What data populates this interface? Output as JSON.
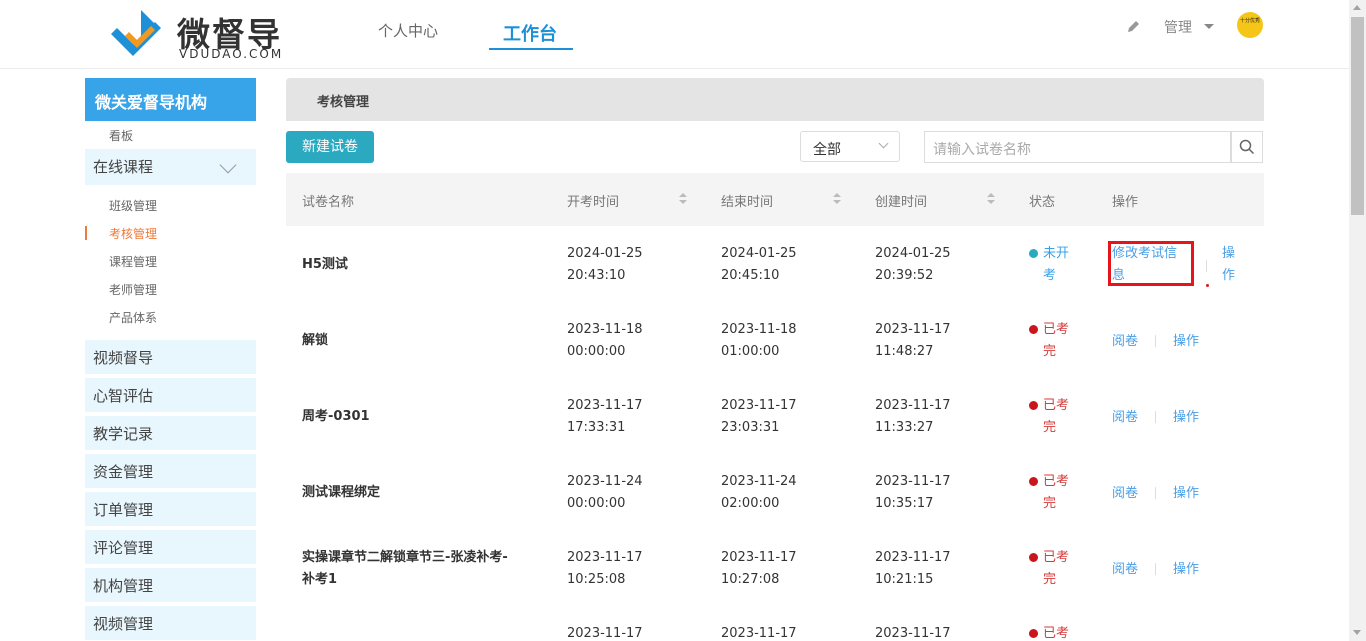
{
  "header": {
    "logo_title": "微督导",
    "logo_sub": "VDUDAO.COM",
    "nav": [
      "个人中心",
      "工作台"
    ],
    "manage_label": "管理",
    "avatar_text": "十分优秀"
  },
  "sidebar": {
    "org_name": "微关爱督导机构",
    "dashboard": "看板",
    "online_course": "在线课程",
    "sub_items": [
      "班级管理",
      "考核管理",
      "课程管理",
      "老师管理",
      "产品体系"
    ],
    "blocks": [
      "视频督导",
      "心智评估",
      "教学记录",
      "资金管理",
      "订单管理",
      "评论管理",
      "机构管理",
      "视频管理"
    ]
  },
  "main": {
    "breadcrumb": "考核管理",
    "new_button": "新建试卷",
    "filter_value": "全部",
    "search_placeholder": "请输入试卷名称",
    "columns": [
      "试卷名称",
      "开考时间",
      "结束时间",
      "创建时间",
      "状态",
      "操作"
    ],
    "rows": [
      {
        "name": "H5测试",
        "start_date": "2024-01-25",
        "start_time": "20:43:10",
        "end_date": "2024-01-25",
        "end_time": "20:45:10",
        "create_date": "2024-01-25",
        "create_time": "20:39:52",
        "status1": "未开",
        "status2": "考",
        "action1a": "修改考试信",
        "action1b": "息",
        "action2a": "操",
        "action2b": "作"
      },
      {
        "name": "解锁",
        "start_date": "2023-11-18",
        "start_time": "00:00:00",
        "end_date": "2023-11-18",
        "end_time": "01:00:00",
        "create_date": "2023-11-17",
        "create_time": "11:48:27",
        "status1": "已考",
        "status2": "完",
        "action1": "阅卷",
        "action2": "操作"
      },
      {
        "name": "周考-0301",
        "start_date": "2023-11-17",
        "start_time": "17:33:31",
        "end_date": "2023-11-17",
        "end_time": "23:03:31",
        "create_date": "2023-11-17",
        "create_time": "11:33:27",
        "status1": "已考",
        "status2": "完",
        "action1": "阅卷",
        "action2": "操作"
      },
      {
        "name": "测试课程绑定",
        "start_date": "2023-11-24",
        "start_time": "00:00:00",
        "end_date": "2023-11-24",
        "end_time": "02:00:00",
        "create_date": "2023-11-17",
        "create_time": "10:35:17",
        "status1": "已考",
        "status2": "完",
        "action1": "阅卷",
        "action2": "操作"
      },
      {
        "name1": "实操课章节二解锁章节三-张凌补考-",
        "name2": "补考1",
        "start_date": "2023-11-17",
        "start_time": "10:25:08",
        "end_date": "2023-11-17",
        "end_time": "10:27:08",
        "create_date": "2023-11-17",
        "create_time": "10:21:15",
        "status1": "已考",
        "status2": "完",
        "action1": "阅卷",
        "action2": "操作"
      },
      {
        "start_date": "2023-11-17",
        "end_date": "2023-11-17",
        "create_date": "2023-11-17",
        "status1": "已考"
      }
    ]
  },
  "colors": {
    "brand_blue": "#37a3e8",
    "teal_button": "#2aa9c0",
    "status_red": "#d63b3b",
    "highlight": "#e8141b",
    "active_orange": "#ee7a3b"
  }
}
